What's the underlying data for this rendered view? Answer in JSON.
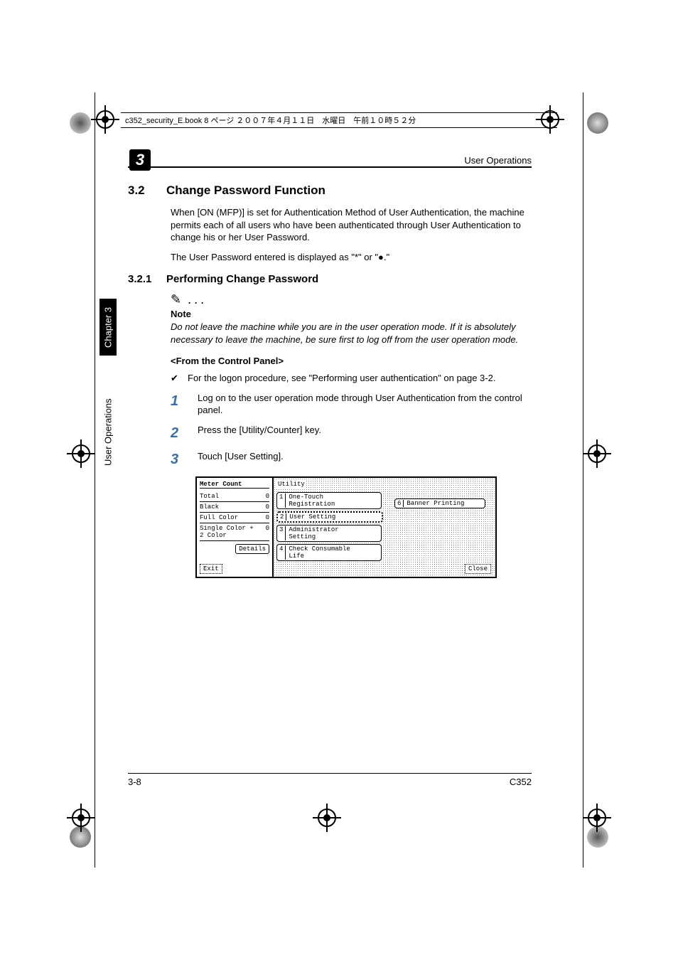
{
  "book_header": "c352_security_E.book  8 ページ  ２００７年４月１１日　水曜日　午前１０時５２分",
  "running_header": "User Operations",
  "chapter_badge": "3",
  "side_tab_black": "Chapter 3",
  "side_tab_white": "User Operations",
  "section": {
    "num": "3.2",
    "title": "Change Password Function"
  },
  "intro_para": "When [ON (MFP)] is set for Authentication Method of User Authentication, the machine permits each of all users who have been authenticated through User Authentication to change his or her User Password.",
  "display_para": "The User Password entered is displayed as \"*\" or \"●.\"",
  "subsection": {
    "num": "3.2.1",
    "title": "Performing Change Password"
  },
  "note_label": "Note",
  "note_body": "Do not leave the machine while you are in the user operation mode. If it is absolutely necessary to leave the machine, be sure first to log off from the user operation mode.",
  "from_panel": "<From the Control Panel>",
  "check_item": "For the logon procedure, see \"Performing user authentication\" on page 3-2.",
  "steps": [
    "Log on to the user operation mode through User Authentication from the control panel.",
    "Press the [Utility/Counter] key.",
    "Touch [User Setting]."
  ],
  "screenshot": {
    "meter_title": "Meter\nCount",
    "rows": [
      {
        "label": "Total",
        "value": "0"
      },
      {
        "label": "Black",
        "value": "0"
      },
      {
        "label": "Full Color",
        "value": "0"
      },
      {
        "label": "Single Color +\n2 Color",
        "value": "0"
      }
    ],
    "details_btn": "Details",
    "exit_btn": "Exit",
    "utility_title": "Utility",
    "menu": [
      {
        "n": "1",
        "label": "One-Touch\nRegistration"
      },
      {
        "n": "2",
        "label": "User Setting"
      },
      {
        "n": "3",
        "label": "Administrator\nSetting"
      },
      {
        "n": "4",
        "label": "Check Consumable\nLife"
      }
    ],
    "menu6": {
      "n": "6",
      "label": "Banner Printing"
    },
    "close_btn": "Close"
  },
  "footer_left": "3-8",
  "footer_right": "C352"
}
